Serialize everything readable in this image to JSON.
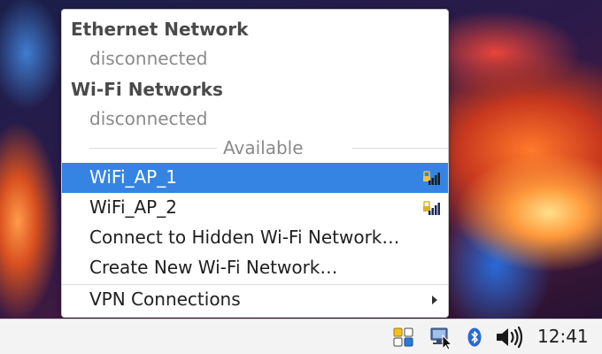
{
  "menu": {
    "ethernet_header": "Ethernet Network",
    "ethernet_status": "disconnected",
    "wifi_header": "Wi-Fi Networks",
    "wifi_status": "disconnected",
    "available_label": "Available",
    "networks": [
      {
        "ssid": "WiFi_AP_1",
        "selected": true,
        "secured": true,
        "signal_icon": "signal-lock-icon"
      },
      {
        "ssid": "WiFi_AP_2",
        "selected": false,
        "secured": true,
        "signal_icon": "signal-lock-icon"
      }
    ],
    "connect_hidden": "Connect to Hidden Wi-Fi Network…",
    "create_new": "Create New Wi-Fi Network…",
    "vpn": "VPN Connections"
  },
  "taskbar": {
    "icons": [
      "applets-icon",
      "network-icon",
      "bluetooth-icon",
      "volume-icon"
    ],
    "clock": "12:41"
  },
  "colors": {
    "selection": "#3584e4",
    "taskbar_bg": "#f3f3f3"
  }
}
